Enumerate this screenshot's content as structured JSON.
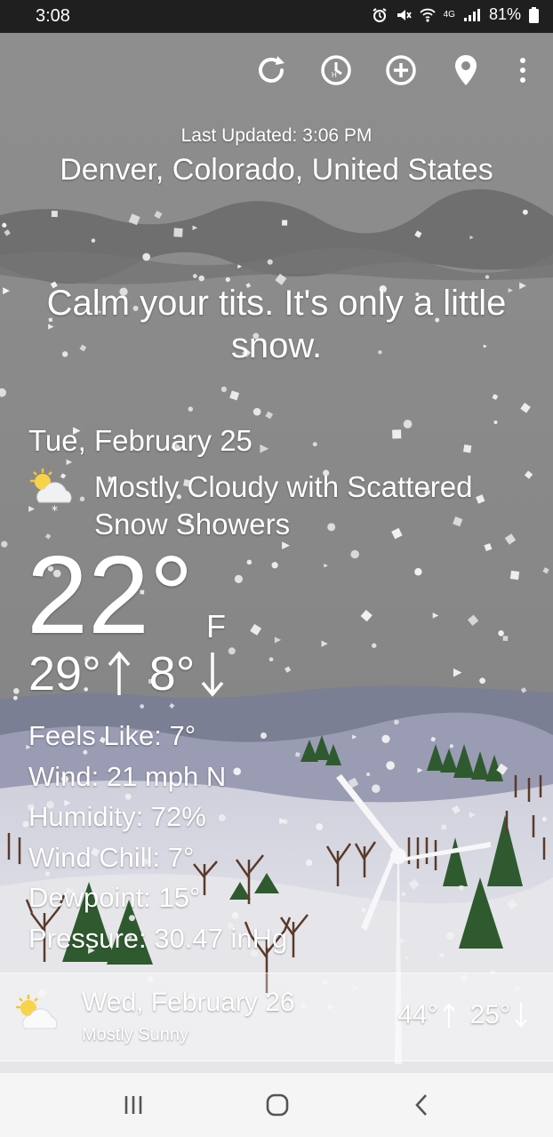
{
  "status_bar": {
    "time": "3:08",
    "icons": [
      "alarm-icon",
      "mute-icon",
      "wifi-icon",
      "lte-signal-icon"
    ],
    "network_label": "4G",
    "battery_percent": "81%"
  },
  "toolbar": {
    "buttons": [
      "refresh-icon",
      "hourly-icon",
      "add-location-icon",
      "location-pin-icon",
      "more-vert-icon"
    ]
  },
  "header": {
    "last_updated": "Last Updated: 3:06 PM",
    "location": "Denver, Colorado, United States"
  },
  "quip": {
    "line1": "Calm your tits. It's only a little",
    "line2": "snow."
  },
  "today": {
    "date": "Tue, February 25",
    "condition_line1": "Mostly Cloudy with Scattered",
    "condition_line2": "Snow Showers",
    "temperature": "22°",
    "unit": "F",
    "high": "29°",
    "low": "8°",
    "details": {
      "feels_like": "Feels Like: 7°",
      "wind": "Wind: 21 mph N",
      "humidity": "Humidity: 72%",
      "wind_chill": "Wind Chill: 7°",
      "dewpoint": "Dewpoint: 15°",
      "pressure": "Pressure: 30.47 inHg"
    }
  },
  "forecast": [
    {
      "date": "Wed, February 26",
      "condition": "Mostly Sunny",
      "high": "44°",
      "low": "25°"
    }
  ],
  "nav_bar": {
    "buttons": [
      "recents-button",
      "home-button",
      "back-button"
    ]
  },
  "colors": {
    "sky": "#8a8a8a",
    "snow_ground": "#e8e8ec",
    "tree_green": "#2f5a2f",
    "accent_white": "#ffffff"
  }
}
